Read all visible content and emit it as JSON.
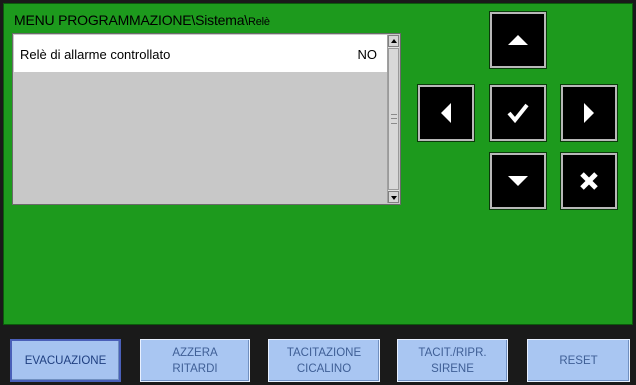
{
  "header": {
    "title_main": "MENU PROGRAMMAZIONE\\Sistema\\",
    "title_tail": "Relè"
  },
  "list": {
    "items": [
      {
        "label": "Relè di allarme controllato",
        "value": "NO"
      }
    ]
  },
  "nav": {
    "up": "arrow-up-icon",
    "left": "arrow-left-icon",
    "confirm": "check-icon",
    "right": "arrow-right-icon",
    "down": "arrow-down-icon",
    "cancel": "cancel-x-icon"
  },
  "function_buttons": [
    {
      "label": "EVACUAZIONE"
    },
    {
      "label": "AZZERA\nRITARDI"
    },
    {
      "label": "TACITAZIONE\nCICALINO"
    },
    {
      "label": "TACIT./RIPR.\nSIRENE"
    },
    {
      "label": "RESET"
    }
  ],
  "colors": {
    "background": "#1d9a1d",
    "button_face": "#a9c6f2",
    "button_text": "#3f5f96",
    "nav_button": "#000000"
  }
}
